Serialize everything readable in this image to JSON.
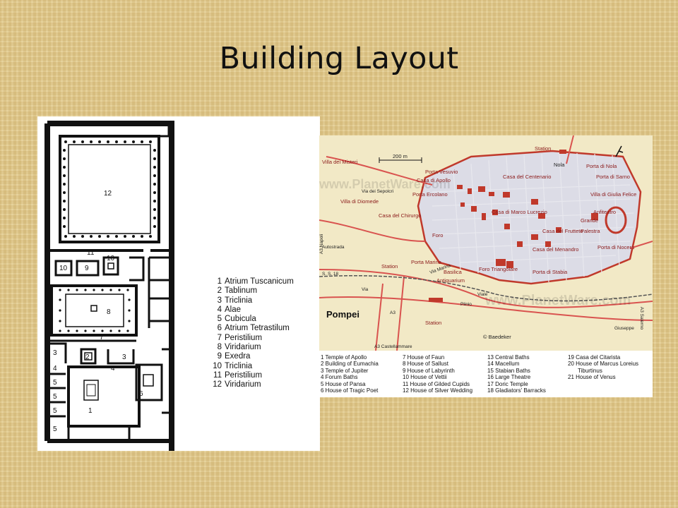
{
  "slide": {
    "title": "Building Layout"
  },
  "floor_plan": {
    "room_numbers": [
      "1",
      "2",
      "3",
      "4",
      "5",
      "6",
      "7",
      "8",
      "9",
      "10",
      "11",
      "12"
    ],
    "legend": [
      {
        "num": "1",
        "label": "Atrium Tuscanicum"
      },
      {
        "num": "2",
        "label": "Tablinum"
      },
      {
        "num": "3",
        "label": "Triclinia"
      },
      {
        "num": "4",
        "label": "Alae"
      },
      {
        "num": "5",
        "label": "Cubicula"
      },
      {
        "num": "6",
        "label": "Atrium Tetrastilum"
      },
      {
        "num": "7",
        "label": "Peristilium"
      },
      {
        "num": "8",
        "label": "Viridarium"
      },
      {
        "num": "9",
        "label": "Exedra"
      },
      {
        "num": "10",
        "label": "Triclinia"
      },
      {
        "num": "11",
        "label": "Peristilium"
      },
      {
        "num": "12",
        "label": "Viridarium"
      }
    ]
  },
  "map": {
    "title": "Pompei",
    "scale": "200 m",
    "publisher": "© Baedeker",
    "watermark": "www.PlanetWare.com",
    "labels": {
      "villa_misteri": "Villa dei Misteri",
      "villa_diomede": "Villa di Diomede",
      "porta_vesuvio": "Porta Vesuvio",
      "casa_apollo": "Casa di Apollo",
      "porta_ercolano": "Porta Ercolano",
      "casa_chirurgo": "Casa del Chirurgo",
      "via_sepolcri": "Via dei Sepolcri",
      "station_top": "Station",
      "porta_nola": "Porta di Nola",
      "nola": "Nola",
      "casa_centenario": "Casa del Centenario",
      "casa_marco": "Casa di Marco Lucrezio",
      "porta_sarno": "Porta di Sarno",
      "villa_giulia": "Villa di Giulia Felice",
      "anfiteatro": "Anfiteatro",
      "grande": "Grande",
      "palestra": "Palestra",
      "casa_frutteto": "Casa del Frutteto",
      "casa_menandro": "Casa del Menandro",
      "porta_nocera": "Porta di Nocera",
      "foro": "Foro",
      "porta_marina": "Porta Marina",
      "basilica": "Basilica",
      "antiquarium": "Antiquarium",
      "foro_triangolare": "Foro Triangolare",
      "porta_stabia": "Porta di Stabia",
      "station_left": "Station",
      "station_bottom": "Station",
      "autostrada": "Autostrada",
      "a3_napoli": "A3 Napoli",
      "a3_salerno": "A3 Salerno",
      "a3_castellammare": "A3 Castellammare",
      "ss18": "S. S. 18",
      "via": "Via",
      "viale": "Viale",
      "plinio": "Plinio",
      "giuseppe": "Giuseppe",
      "via_marina": "Via Marina",
      "a3": "A3"
    },
    "legend": [
      "1 Temple of Apollo",
      "2 Building of Eumachia",
      "3 Temple of Jupiter",
      "4 Forum Baths",
      "5 House of Pansa",
      "6 House of Tragic Poet",
      "7 House of Faun",
      "8 House of Sallust",
      "9 House of Labyrinth",
      "10 House of Vettii",
      "11 House of Gilded Cupids",
      "12 House of Silver Wedding",
      "13 Central Baths",
      "14 Macellum",
      "15 Stabian Baths",
      "16 Large Theatre",
      "17 Doric Temple",
      "18 Gladiators' Barracks",
      "19 Casa del Citarista",
      "20 House of Marcus Loreius",
      "Tiburtinus",
      "21 House of Venus"
    ]
  },
  "colors": {
    "background": "#e3cc8e",
    "map_land": "#f2e9c6",
    "city_fill": "#dcdce6",
    "roads": "#d9534f",
    "buildings": "#c0392b"
  }
}
